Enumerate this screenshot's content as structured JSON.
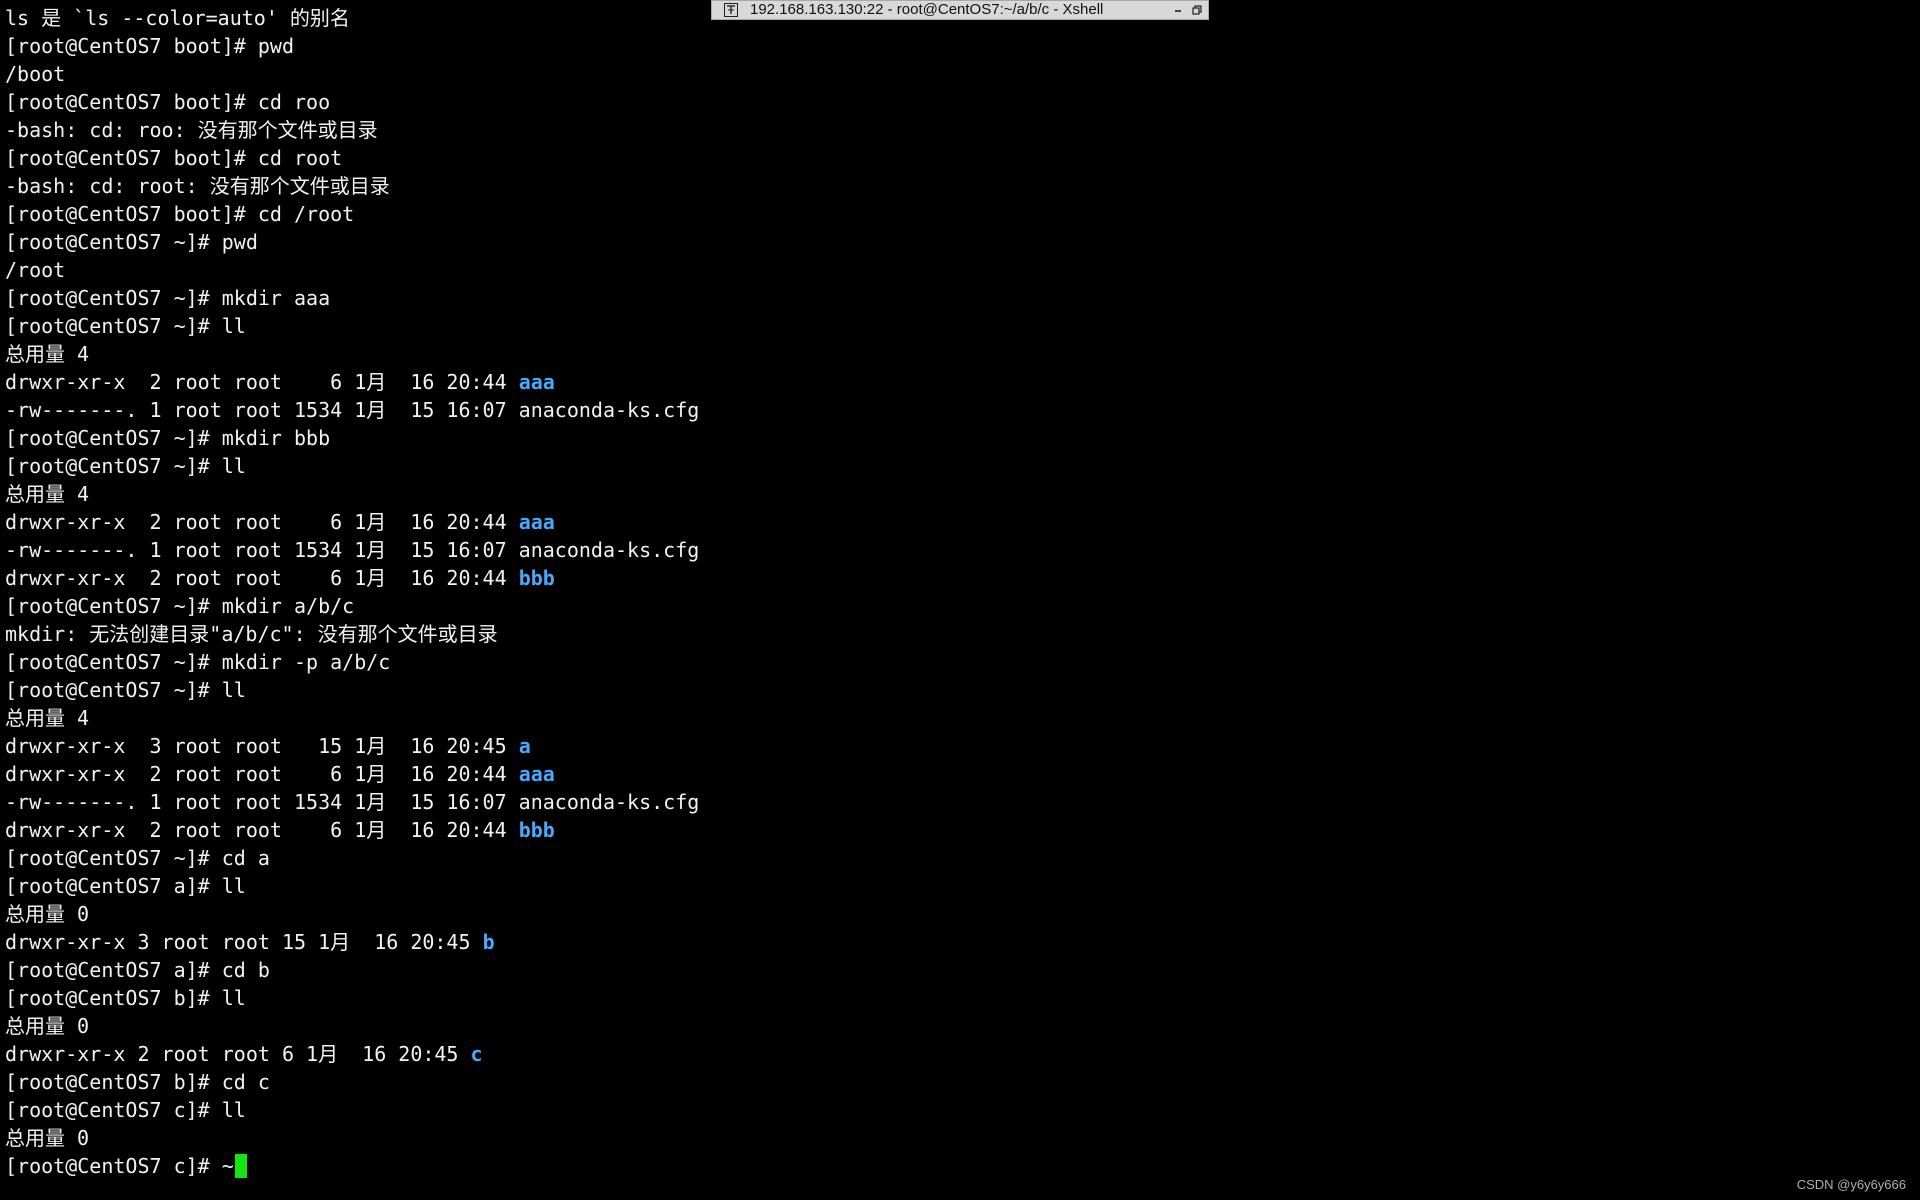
{
  "window": {
    "title": "192.168.163.130:22 - root@CentOS7:~/a/b/c - Xshell",
    "pin_icon": "pin-icon",
    "minimize_icon": "minimize-icon",
    "restore_icon": "restore-icon"
  },
  "colors": {
    "background": "#000000",
    "text": "#f2f2f2",
    "directory": "#47a9ff",
    "cursor": "#13e513"
  },
  "terminal": {
    "lines": [
      {
        "text": "ls 是 `ls --color=auto' 的别名"
      },
      {
        "text": "[root@CentOS7 boot]# pwd"
      },
      {
        "text": "/boot"
      },
      {
        "text": "[root@CentOS7 boot]# cd roo"
      },
      {
        "text": "-bash: cd: roo: 没有那个文件或目录"
      },
      {
        "text": "[root@CentOS7 boot]# cd root"
      },
      {
        "text": "-bash: cd: root: 没有那个文件或目录"
      },
      {
        "text": "[root@CentOS7 boot]# cd /root"
      },
      {
        "text": "[root@CentOS7 ~]# pwd"
      },
      {
        "text": "/root"
      },
      {
        "text": "[root@CentOS7 ~]# mkdir aaa"
      },
      {
        "text": "[root@CentOS7 ~]# ll"
      },
      {
        "text": "总用量 4"
      },
      {
        "text": "drwxr-xr-x  2 root root    6 1月  16 20:44 ",
        "dir": "aaa"
      },
      {
        "text": "-rw-------. 1 root root 1534 1月  15 16:07 anaconda-ks.cfg"
      },
      {
        "text": "[root@CentOS7 ~]# mkdir bbb"
      },
      {
        "text": "[root@CentOS7 ~]# ll"
      },
      {
        "text": "总用量 4"
      },
      {
        "text": "drwxr-xr-x  2 root root    6 1月  16 20:44 ",
        "dir": "aaa"
      },
      {
        "text": "-rw-------. 1 root root 1534 1月  15 16:07 anaconda-ks.cfg"
      },
      {
        "text": "drwxr-xr-x  2 root root    6 1月  16 20:44 ",
        "dir": "bbb"
      },
      {
        "text": "[root@CentOS7 ~]# mkdir a/b/c"
      },
      {
        "text": "mkdir: 无法创建目录\"a/b/c\": 没有那个文件或目录"
      },
      {
        "text": "[root@CentOS7 ~]# mkdir -p a/b/c"
      },
      {
        "text": "[root@CentOS7 ~]# ll"
      },
      {
        "text": "总用量 4"
      },
      {
        "text": "drwxr-xr-x  3 root root   15 1月  16 20:45 ",
        "dir": "a"
      },
      {
        "text": "drwxr-xr-x  2 root root    6 1月  16 20:44 ",
        "dir": "aaa"
      },
      {
        "text": "-rw-------. 1 root root 1534 1月  15 16:07 anaconda-ks.cfg"
      },
      {
        "text": "drwxr-xr-x  2 root root    6 1月  16 20:44 ",
        "dir": "bbb"
      },
      {
        "text": "[root@CentOS7 ~]# cd a"
      },
      {
        "text": "[root@CentOS7 a]# ll"
      },
      {
        "text": "总用量 0"
      },
      {
        "text": "drwxr-xr-x 3 root root 15 1月  16 20:45 ",
        "dir": "b"
      },
      {
        "text": "[root@CentOS7 a]# cd b"
      },
      {
        "text": "[root@CentOS7 b]# ll"
      },
      {
        "text": "总用量 0"
      },
      {
        "text": "drwxr-xr-x 2 root root 6 1月  16 20:45 ",
        "dir": "c"
      },
      {
        "text": "[root@CentOS7 b]# cd c"
      },
      {
        "text": "[root@CentOS7 c]# ll"
      },
      {
        "text": "总用量 0"
      }
    ],
    "prompt": "[root@CentOS7 c]# ~"
  },
  "watermark": "CSDN @y6y6y666"
}
